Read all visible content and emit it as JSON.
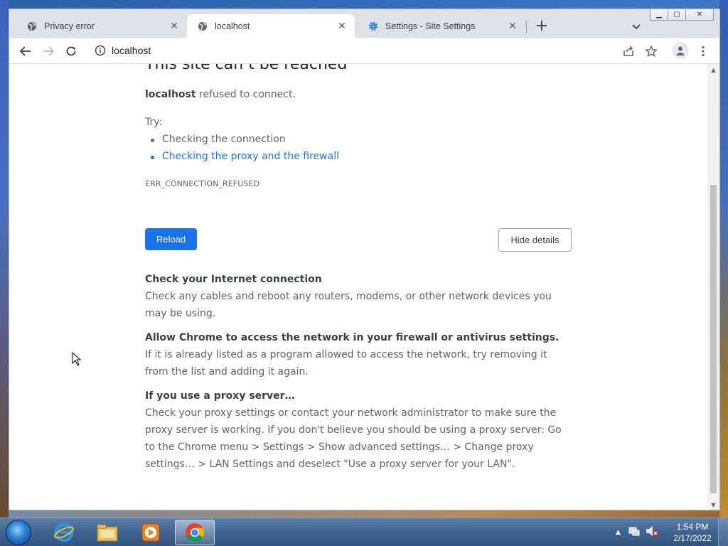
{
  "browser": {
    "tabs": [
      {
        "label": "Privacy error",
        "icon": "globe-icon",
        "active": false
      },
      {
        "label": "localhost",
        "icon": "globe-icon",
        "active": true
      },
      {
        "label": "Settings - Site Settings",
        "icon": "gear-icon",
        "active": false
      }
    ],
    "new_tab_label": "+",
    "address": "localhost"
  },
  "page": {
    "heading": "This site can’t be reached",
    "host": "localhost",
    "refused_text": "refused to connect.",
    "try_label": "Try:",
    "suggestions": [
      "Checking the connection",
      "Checking the proxy and the firewall"
    ],
    "error_code": "ERR_CONNECTION_REFUSED",
    "reload_label": "Reload",
    "hide_details_label": "Hide details",
    "sections": [
      {
        "title": "Check your Internet connection",
        "text": "Check any cables and reboot any routers, modems, or other network devices you may be using."
      },
      {
        "title": "Allow Chrome to access the network in your firewall or antivirus settings.",
        "text": "If it is already listed as a program allowed to access the network, try removing it from the list and adding it again."
      },
      {
        "title": "If you use a proxy server…",
        "text": "Check your proxy settings or contact your network administrator to make sure the proxy server is working. If you don't believe you should be using a proxy server: Go to the Chrome menu > Settings > Show advanced settings… > Change proxy settings… > LAN Settings and deselect \"Use a proxy server for your LAN\"."
      }
    ]
  },
  "taskbar": {
    "time": "1:54 PM",
    "date": "2/17/2022",
    "pinned": [
      "internet-explorer-icon",
      "file-explorer-icon",
      "media-player-icon",
      "chrome-icon"
    ]
  },
  "colors": {
    "accent": "#1a73e8",
    "text": "#5f6368",
    "heading": "#202124"
  }
}
